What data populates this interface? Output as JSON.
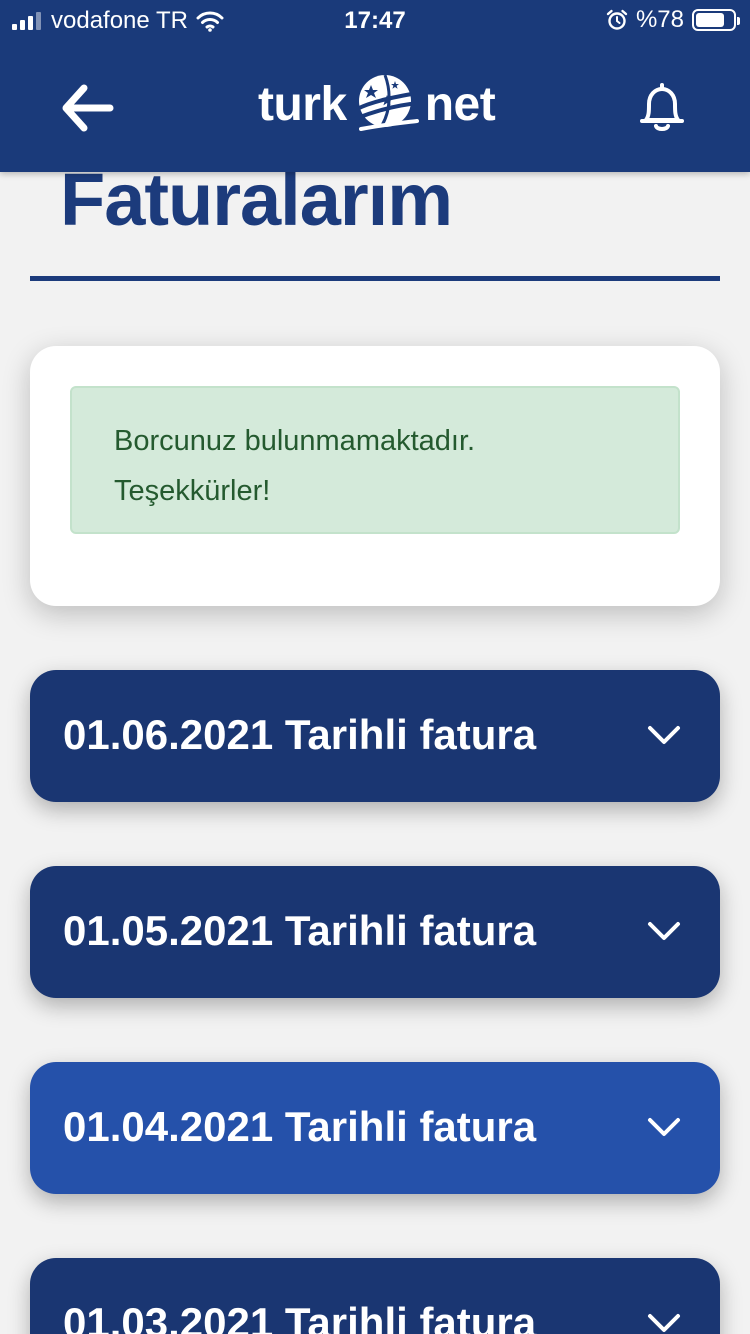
{
  "status_bar": {
    "carrier": "vodafone TR",
    "time": "17:47",
    "battery_text": "%78",
    "battery_level": 0.78
  },
  "header": {
    "logo_left": "turk",
    "logo_right": "net"
  },
  "page": {
    "title": "Faturalarım"
  },
  "notice": {
    "line1": "Borcunuz bulunmamaktadır.",
    "line2": "Teşekkürler!"
  },
  "invoices": [
    {
      "label": "01.06.2021 Tarihli fatura"
    },
    {
      "label": "01.05.2021 Tarihli fatura"
    },
    {
      "label": "01.04.2021 Tarihli fatura",
      "highlighted": true
    },
    {
      "label": "01.03.2021 Tarihli fatura"
    }
  ],
  "colors": {
    "header_bg": "#1a3a7a",
    "title": "#1c3b7c",
    "invoice_bg": "#1a3672",
    "invoice_active_bg": "#2551aa",
    "alert_bg": "#d4eada",
    "alert_text": "#245a2f"
  },
  "icons": {
    "back": "arrow-left-icon",
    "notifications": "bell-icon",
    "expand": "chevron-down-icon"
  }
}
